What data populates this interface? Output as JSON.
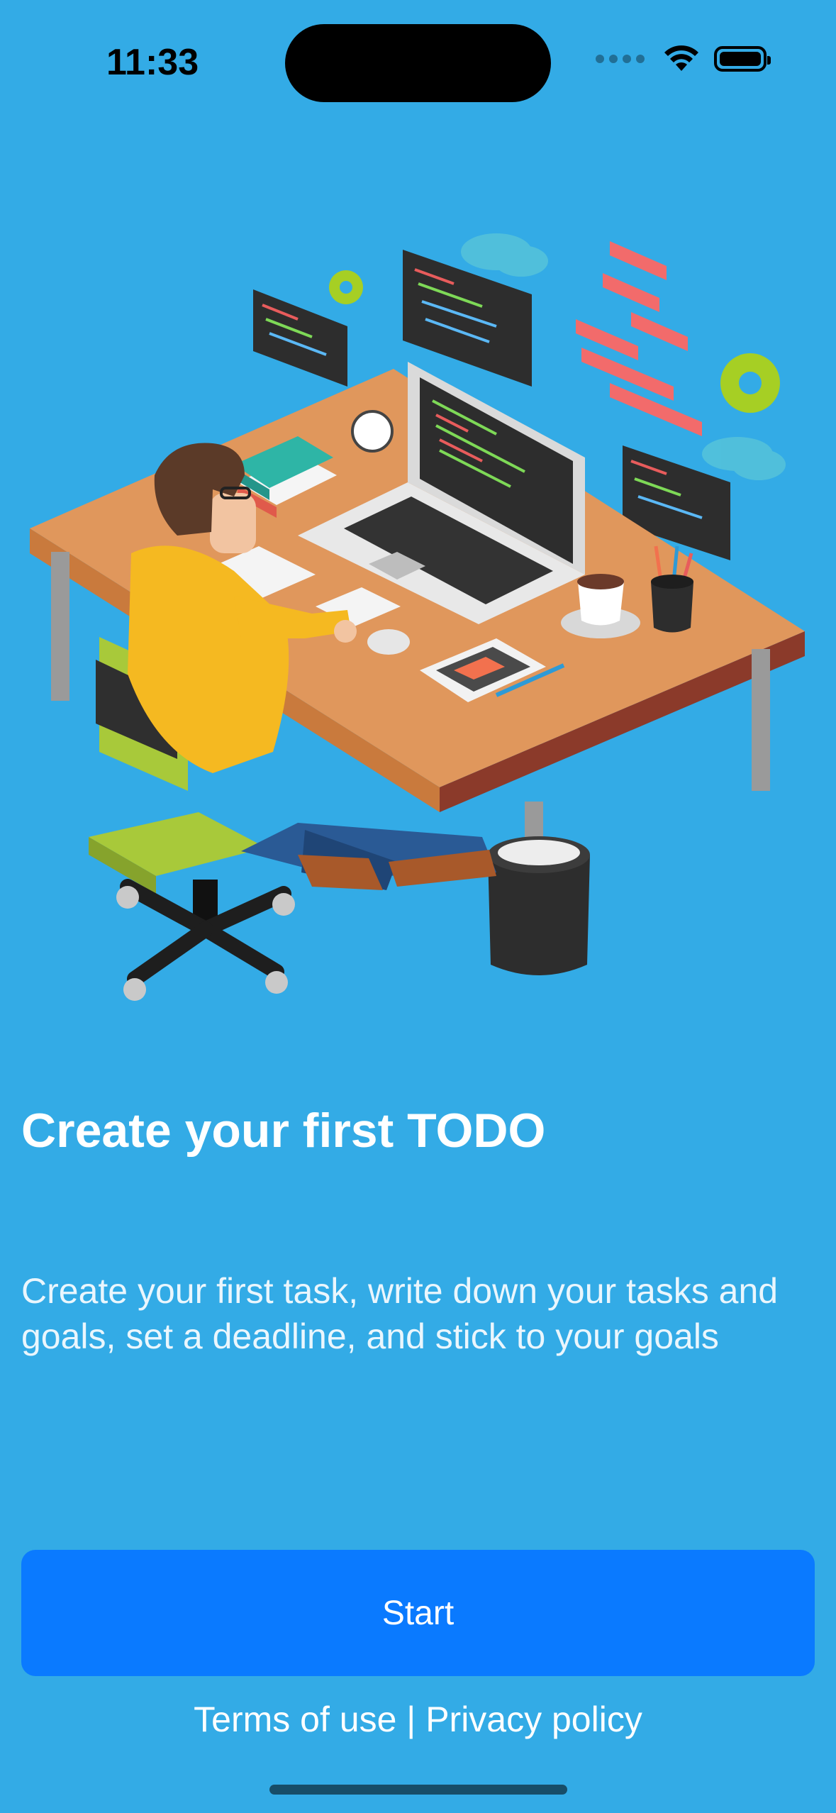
{
  "status_bar": {
    "time": "11:33",
    "wifi_icon": "wifi-icon",
    "battery_icon": "battery-icon"
  },
  "onboarding": {
    "illustration": "developer-desk-illustration",
    "title": "Create your first TODO",
    "description": "Create your first task, write down your tasks and goals, set a deadline, and stick to your goals",
    "start_label": "Start"
  },
  "footer": {
    "terms_label": "Terms of use",
    "separator": "|",
    "privacy_label": "Privacy policy"
  },
  "colors": {
    "background": "#33ABE6",
    "button": "#0A7AFF",
    "text": "#FFFFFF"
  }
}
